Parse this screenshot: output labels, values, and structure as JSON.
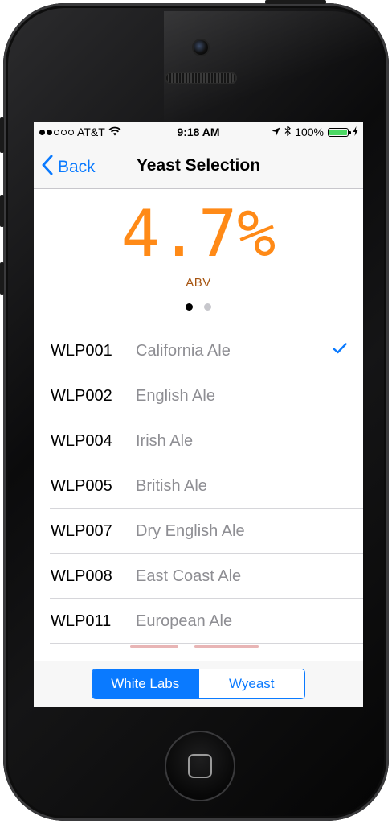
{
  "status_bar": {
    "carrier": "AT&T",
    "signal_bars_filled": 2,
    "signal_bars_total": 5,
    "time": "9:18 AM",
    "battery": "100%",
    "icons": [
      "wifi-icon",
      "location-arrow-icon",
      "bluetooth-icon",
      "battery-icon",
      "charging-bolt-icon"
    ]
  },
  "nav": {
    "back_label": "Back",
    "title": "Yeast Selection"
  },
  "header": {
    "abv_value": "4.7%",
    "abv_label": "ABV",
    "page_count": 2,
    "active_page": 0
  },
  "yeasts": [
    {
      "code": "WLP001",
      "name": "California Ale",
      "selected": true
    },
    {
      "code": "WLP002",
      "name": "English Ale",
      "selected": false
    },
    {
      "code": "WLP004",
      "name": "Irish Ale",
      "selected": false
    },
    {
      "code": "WLP005",
      "name": "British Ale",
      "selected": false
    },
    {
      "code": "WLP007",
      "name": "Dry English Ale",
      "selected": false
    },
    {
      "code": "WLP008",
      "name": "East Coast Ale",
      "selected": false
    },
    {
      "code": "WLP011",
      "name": "European Ale",
      "selected": false
    }
  ],
  "segmented_control": {
    "options": [
      "White Labs",
      "Wyeast"
    ],
    "selected_index": 0
  },
  "colors": {
    "accent_blue": "#0a7aff",
    "abv_orange": "#ff8a17",
    "abv_label_brown": "#a65410",
    "secondary_text": "#8e8e93",
    "battery_green": "#4cd964"
  }
}
